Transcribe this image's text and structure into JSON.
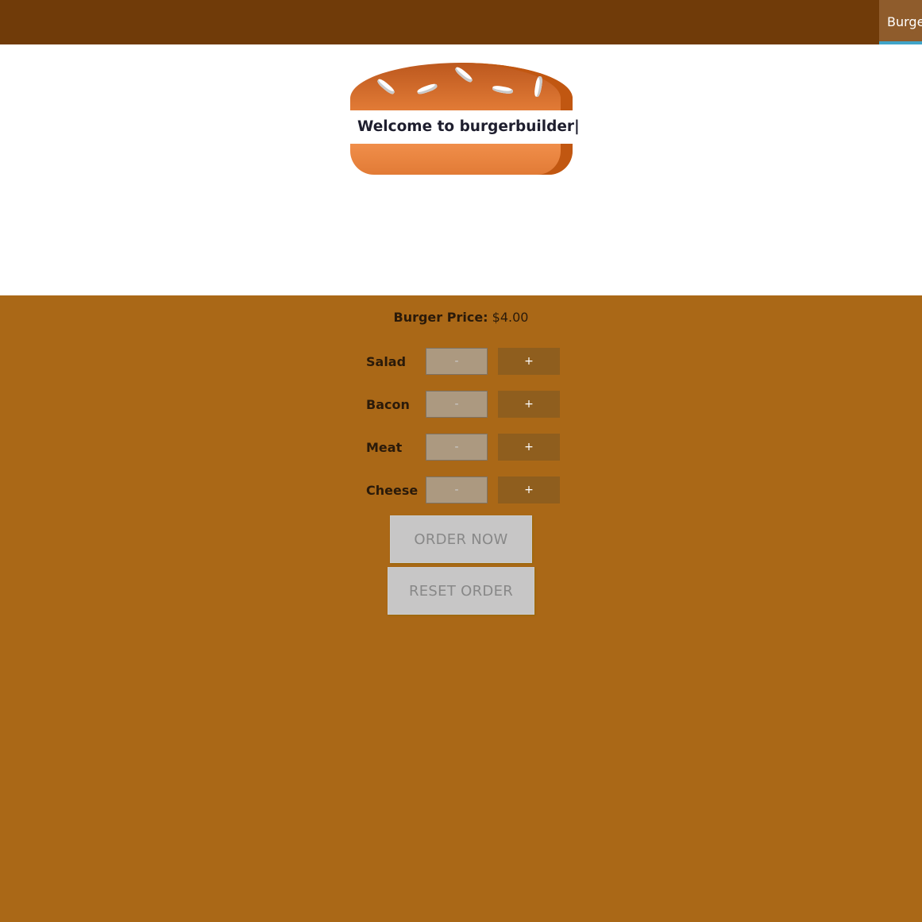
{
  "toolbar": {
    "nav_label": "Burge"
  },
  "burger": {
    "welcome_text": "Welcome to burgerbuilder|"
  },
  "price": {
    "label": "Burger Price:",
    "value": "$4.00"
  },
  "controls": [
    {
      "label": "Salad",
      "less": "-",
      "more": "+"
    },
    {
      "label": "Bacon",
      "less": "-",
      "more": "+"
    },
    {
      "label": "Meat",
      "less": "-",
      "more": "+"
    },
    {
      "label": "Cheese",
      "less": "-",
      "more": "+"
    }
  ],
  "actions": {
    "order_label": "ORDER NOW",
    "reset_label": "RESET ORDER"
  },
  "colors": {
    "toolbar": "#703B09",
    "controls_bg": "#AA6817",
    "more_button": "#8F5E1E",
    "less_button": "#AC9980",
    "active_underline": "#40A4C8"
  }
}
